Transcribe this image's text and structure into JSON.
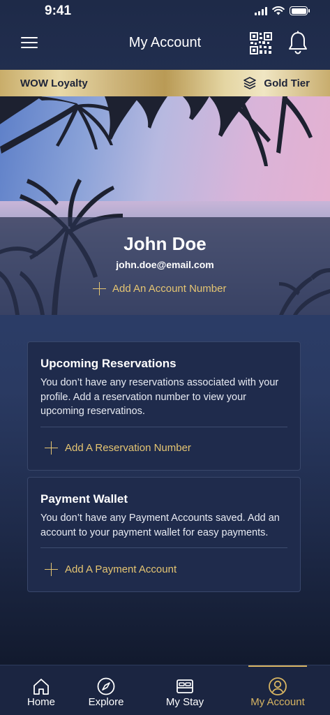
{
  "status_bar": {
    "time": "9:41"
  },
  "nav": {
    "title": "My Account"
  },
  "loyalty": {
    "program_name": "WOW Loyalty",
    "tier": "Gold Tier"
  },
  "profile": {
    "name": "John Doe",
    "email": "john.doe@email.com",
    "add_account_label": "Add An Account Number"
  },
  "reservations_card": {
    "title": "Upcoming Reservations",
    "body": "You don’t have any reservations associated with your profile. Add a reservation number to view your upcoming reservatinos.",
    "action_label": "Add A Reservation Number"
  },
  "wallet_card": {
    "title": "Payment Wallet",
    "body": "You don’t have any Payment Accounts saved. Add an account to your payment wallet for easy payments.",
    "action_label": "Add A Payment Account"
  },
  "tabs": [
    {
      "label": "Home",
      "icon": "home-icon",
      "active": false
    },
    {
      "label": "Explore",
      "icon": "compass-icon",
      "active": false
    },
    {
      "label": "My Stay",
      "icon": "bed-icon",
      "active": false
    },
    {
      "label": "My Account",
      "icon": "user-circle-icon",
      "active": true
    }
  ],
  "colors": {
    "background": "#1e2a48",
    "gold_accent": "#e5c572",
    "tab_active": "#d8b562",
    "card_background": "#1f2b4c"
  }
}
